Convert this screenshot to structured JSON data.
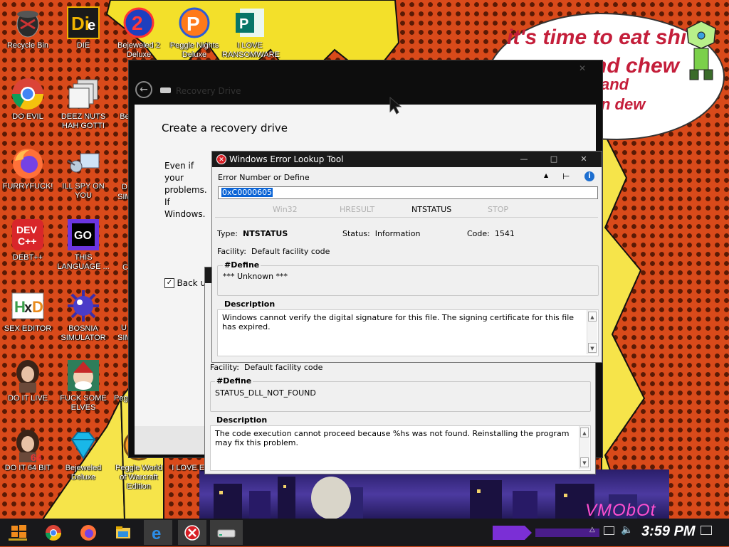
{
  "wallpaper": {
    "speech_lines": [
      "it's time to eat shi",
      "nd chew",
      "and",
      "n dew"
    ],
    "watermark": "VMObOt"
  },
  "desktop": {
    "icons": [
      {
        "label": "Recycle Bin",
        "icon": "recycle-bin-icon"
      },
      {
        "label": "DIE",
        "icon": "die-app-icon"
      },
      {
        "label": "Bejeweled 2 Deluxe",
        "icon": "bejeweled2-icon"
      },
      {
        "label": "Peggle Nights Deluxe",
        "icon": "peggle-nights-icon"
      },
      {
        "label": "I LOVE RANSOMWARE",
        "icon": "publisher-icon"
      },
      {
        "label": "DO EVIL",
        "icon": "chrome-icon"
      },
      {
        "label": "DEEZ NUTS HAH GOTTI",
        "icon": "stacked-windows-icon"
      },
      {
        "label": "FURRYFUCK!",
        "icon": "firefox-icon"
      },
      {
        "label": "ILL SPY ON YOU",
        "icon": "network-spy-icon"
      },
      {
        "label": "DEBT++",
        "icon": "devcpp-icon"
      },
      {
        "label": "THIS LANGUAGE ...",
        "icon": "goland-icon"
      },
      {
        "label": "SEX EDITOR",
        "icon": "hxd-icon"
      },
      {
        "label": "BOSNIA SIMULATOR",
        "icon": "mine-icon"
      },
      {
        "label": "DO IT LIVE",
        "icon": "portrait-icon"
      },
      {
        "label": "FUCK SOME ELVES",
        "icon": "elf-game-icon"
      },
      {
        "label": "DO IT 64 BIT",
        "icon": "portrait-64-icon"
      },
      {
        "label": "Bejeweled Deluxe",
        "icon": "diamond-icon"
      },
      {
        "label": "Peggle World of Warcraft Edition",
        "icon": "peggle-wow-icon"
      },
      {
        "label": "I LOVE EMO",
        "icon": "emo-icon"
      }
    ],
    "partial_labels": [
      "Be",
      "D",
      "SIM",
      "C",
      "U",
      "SIM",
      "Pegg"
    ]
  },
  "recovery": {
    "title": "Recovery Drive",
    "heading": "Create a recovery drive",
    "paragraph_lines": [
      "Even if your",
      "problems. If",
      "Windows."
    ],
    "checkbox_label": "Back up",
    "checkbox_checked": true
  },
  "lookup_main": {
    "title": "Windows Error Lookup Tool",
    "field_label": "Error Number or Define",
    "field_value": "0xC0000605",
    "tabs": [
      {
        "label": "Win32",
        "active": false
      },
      {
        "label": "HRESULT",
        "active": false
      },
      {
        "label": "NTSTATUS",
        "active": true
      },
      {
        "label": "STOP",
        "active": false
      }
    ],
    "type_label": "Type:",
    "type_value": "NTSTATUS",
    "status_label": "Status:",
    "status_value": "Information",
    "code_label": "Code:",
    "code_value": "1541",
    "facility_label": "Facility:",
    "facility_value": "Default facility code",
    "define_title": "#Define",
    "define_value": "*** Unknown ***",
    "desc_title": "Description",
    "desc_text": "Windows cannot verify the digital signature for this file. The signing certificate for this file has expired."
  },
  "lookup_back": {
    "facility_label": "Facility:",
    "facility_value": "Default facility code",
    "define_title": "#Define",
    "define_value": "STATUS_DLL_NOT_FOUND",
    "desc_title": "Description",
    "desc_text": "The code execution cannot proceed because %hs was not found. Reinstalling the program may fix this problem."
  },
  "taskbar": {
    "clock": "3:59 PM",
    "apps": [
      "start-icon",
      "chrome-icon",
      "firefox-icon",
      "file-explorer-icon",
      "edge-icon",
      "error-lookup-icon",
      "drive-icon"
    ]
  }
}
